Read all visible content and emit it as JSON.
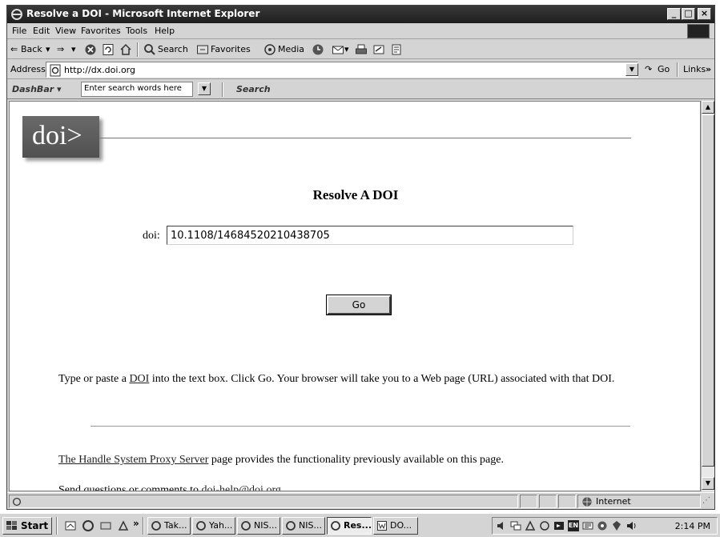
{
  "window": {
    "title": "Resolve a DOI - Microsoft Internet Explorer"
  },
  "menu": {
    "items": [
      "File",
      "Edit",
      "View",
      "Favorites",
      "Tools",
      "Help"
    ]
  },
  "toolbar": {
    "back_label": "Back",
    "search_label": "Search",
    "favorites_label": "Favorites",
    "media_label": "Media"
  },
  "address": {
    "label": "Address",
    "url": "http://dx.doi.org",
    "go_label": "Go",
    "links_label": "Links"
  },
  "dashbar": {
    "label": "DashBar",
    "placeholder": "Enter search words here",
    "search_label": "Search"
  },
  "page": {
    "logo_text": "doi>",
    "title": "Resolve A DOI",
    "doi_label": "doi:",
    "doi_value": "10.1108/14684520210438705",
    "go_button": "Go",
    "instructions_before": "Type or paste a ",
    "instructions_link": "DOI",
    "instructions_after": " into the text box. Click Go. Your browser will take you to a Web page (URL) associated with that DOI.",
    "handle_link": "The Handle System Proxy Server",
    "handle_after": " page provides the functionality previously available on this page.",
    "contact_before": "Send questions or comments to ",
    "contact_link": "doi-help@doi.org"
  },
  "status": {
    "zone": "Internet"
  },
  "taskbar": {
    "start_label": "Start",
    "tasks": [
      "Tak...",
      "Yah...",
      "NIS...",
      "NIS...",
      "Res...",
      "DO..."
    ],
    "active_task": 4,
    "clock": "2:14 PM"
  },
  "colors": {
    "titlebar": "#2a2a2a",
    "chrome": "#d4d4d4",
    "logo_bg": "#5c5c5c"
  }
}
